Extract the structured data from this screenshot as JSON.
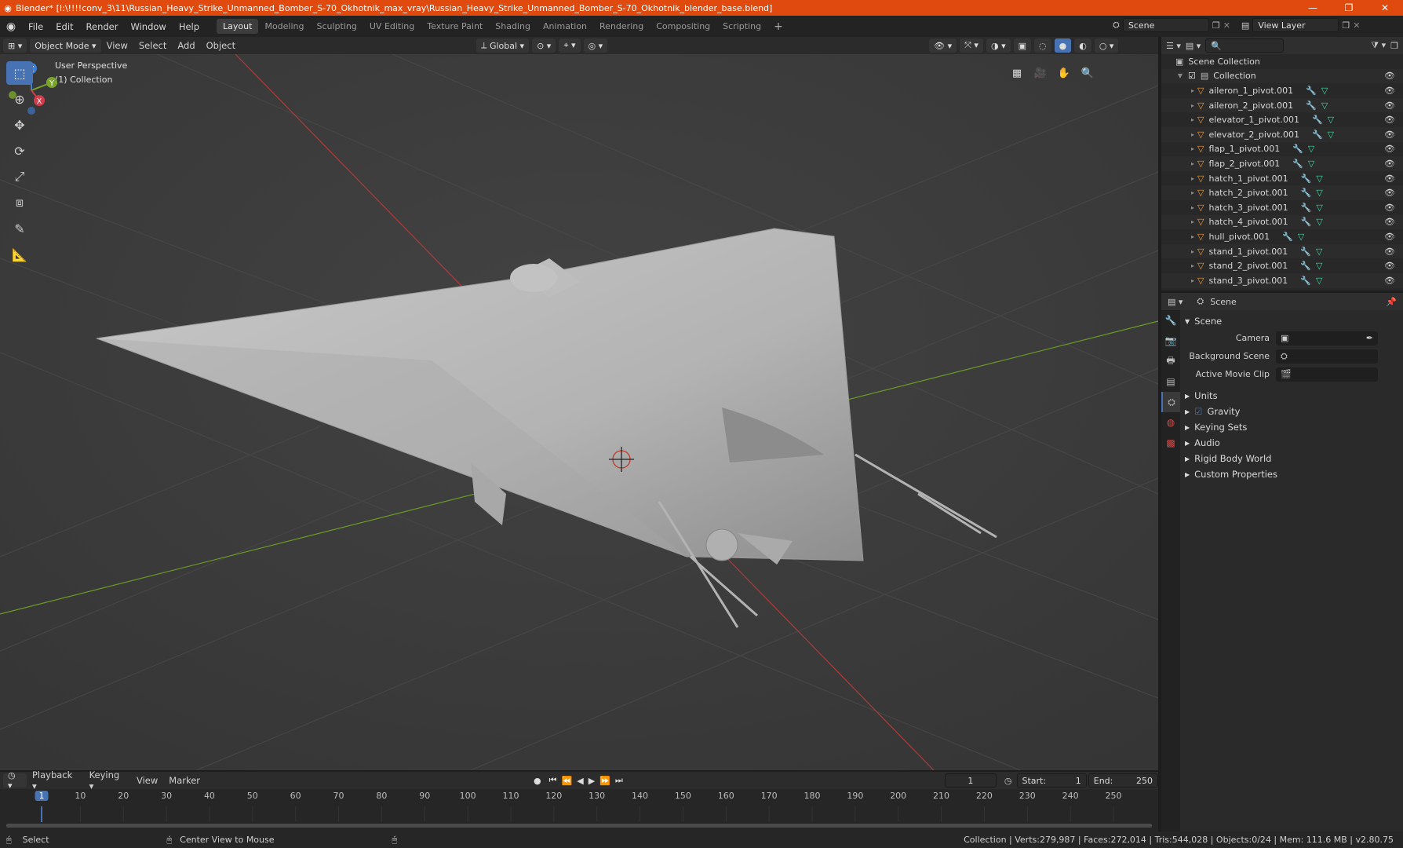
{
  "window": {
    "title": "Blender* [I:\\!!!!conv_3\\11\\Russian_Heavy_Strike_Unmanned_Bomber_S-70_Okhotnik_max_vray\\Russian_Heavy_Strike_Unmanned_Bomber_S-70_Okhotnik_blender_base.blend]"
  },
  "menu": [
    "File",
    "Edit",
    "Render",
    "Window",
    "Help"
  ],
  "workspaces": [
    "Layout",
    "Modeling",
    "Sculpting",
    "UV Editing",
    "Texture Paint",
    "Shading",
    "Animation",
    "Rendering",
    "Compositing",
    "Scripting"
  ],
  "scene_name": "Scene",
  "view_layer": "View Layer",
  "viewport_header": {
    "mode": "Object Mode",
    "menus": [
      "View",
      "Select",
      "Add",
      "Object"
    ],
    "orientation": "Global"
  },
  "viewport": {
    "perspective": "User Perspective",
    "collection": "(1) Collection"
  },
  "gizmo": {
    "z": "Z",
    "y": "Y",
    "x": "X"
  },
  "outliner": {
    "root": "Scene Collection",
    "collection": "Collection",
    "items": [
      "aileron_1_pivot.001",
      "aileron_2_pivot.001",
      "elevator_1_pivot.001",
      "elevator_2_pivot.001",
      "flap_1_pivot.001",
      "flap_2_pivot.001",
      "hatch_1_pivot.001",
      "hatch_2_pivot.001",
      "hatch_3_pivot.001",
      "hatch_4_pivot.001",
      "hull_pivot.001",
      "stand_1_pivot.001",
      "stand_2_pivot.001",
      "stand_3_pivot.001"
    ]
  },
  "properties": {
    "header": "Scene",
    "section": "Scene",
    "fields": [
      {
        "label": "Camera",
        "value": ""
      },
      {
        "label": "Background Scene",
        "value": ""
      },
      {
        "label": "Active Movie Clip",
        "value": ""
      }
    ],
    "subsections": [
      "Units",
      "Gravity",
      "Keying Sets",
      "Audio",
      "Rigid Body World",
      "Custom Properties"
    ]
  },
  "timeline": {
    "menus": [
      "Playback",
      "Keying",
      "View",
      "Marker"
    ],
    "current": "1",
    "start_label": "Start:",
    "start": "1",
    "end_label": "End:",
    "end": "250",
    "ticks": [
      "1",
      "10",
      "20",
      "30",
      "40",
      "50",
      "60",
      "70",
      "80",
      "90",
      "100",
      "110",
      "120",
      "130",
      "140",
      "150",
      "160",
      "170",
      "180",
      "190",
      "200",
      "210",
      "220",
      "230",
      "240",
      "250"
    ]
  },
  "status": {
    "left": "Select",
    "middle": "Center View to Mouse",
    "right": "Collection | Verts:279,987 | Faces:272,014 | Tris:544,028 | Objects:0/24 | Mem: 111.6 MB | v2.80.75"
  },
  "colors": {
    "accent": "#4772b3",
    "titlebar": "#e14a0e",
    "x_axis": "#c83c3c",
    "y_axis": "#7aa52a"
  }
}
